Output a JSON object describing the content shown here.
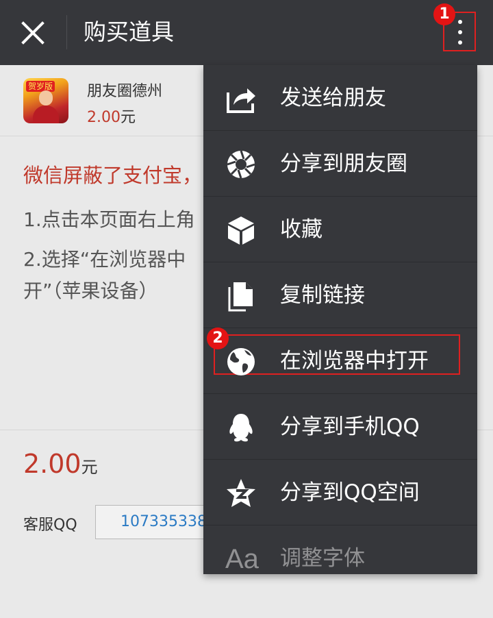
{
  "topbar": {
    "title": "购买道具"
  },
  "annotations": {
    "badge1": "1",
    "badge2": "2"
  },
  "product": {
    "thumb_tag": "贺岁版",
    "name": "朋友圈德州",
    "price": "2.00",
    "unit": "元"
  },
  "notice": {
    "warning": "微信屏蔽了支付宝，",
    "line1": "1.点击本页面右上角",
    "line2": "2.选择“在浏览器中",
    "line3": "开”（苹果设备）"
  },
  "footer": {
    "total_price": "2.00",
    "total_unit": "元",
    "qq_label": "客服QQ",
    "qq_number": "107335338"
  },
  "menu": {
    "items": [
      {
        "label": "发送给朋友",
        "icon": "share-arrow-icon"
      },
      {
        "label": "分享到朋友圈",
        "icon": "moments-aperture-icon"
      },
      {
        "label": "收藏",
        "icon": "favorite-cube-icon"
      },
      {
        "label": "复制链接",
        "icon": "copy-link-icon"
      },
      {
        "label": "在浏览器中打开",
        "icon": "globe-icon"
      },
      {
        "label": "分享到手机QQ",
        "icon": "qq-penguin-icon"
      },
      {
        "label": "分享到QQ空间",
        "icon": "qzone-star-icon"
      },
      {
        "label": "调整字体",
        "icon": "font-size-icon",
        "glyph": "Aa"
      }
    ]
  },
  "colors": {
    "topbar_bg": "#36373b",
    "menu_bg": "#36373b",
    "accent_red": "#c0392b",
    "annotation_red": "#e02020",
    "link_blue": "#2a7ac4"
  }
}
